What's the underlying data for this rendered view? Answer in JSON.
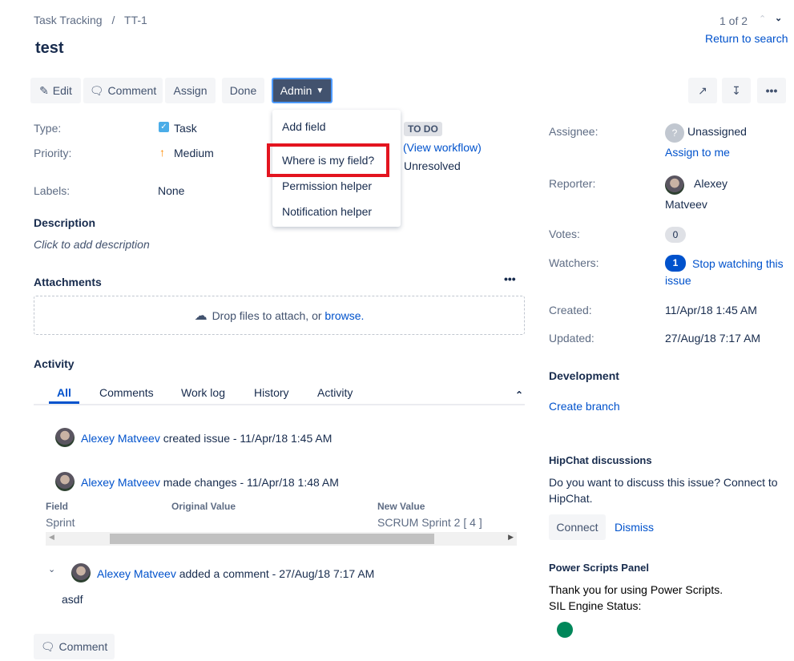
{
  "breadcrumb": {
    "project": "Task Tracking",
    "sep": "/",
    "issue_key": "TT-1"
  },
  "title": "test",
  "pager": {
    "text": "1 of 2",
    "return": "Return to search"
  },
  "toolbar": {
    "edit": "Edit",
    "comment": "Comment",
    "assign": "Assign",
    "done": "Done",
    "admin": "Admin"
  },
  "admin_menu": [
    "Add field",
    "Where is my field?",
    "Permission helper",
    "Notification helper"
  ],
  "details": {
    "type_label": "Type:",
    "type": "Task",
    "priority_label": "Priority:",
    "priority": "Medium",
    "labels_label": "Labels:",
    "labels": "None",
    "status": "TO DO",
    "view_workflow": "(View workflow)",
    "resolution": "Unresolved"
  },
  "description": {
    "heading": "Description",
    "placeholder": "Click to add description"
  },
  "attachments": {
    "heading": "Attachments",
    "drop": "Drop files to attach, or ",
    "browse": "browse."
  },
  "activity": {
    "heading": "Activity",
    "tabs": [
      "All",
      "Comments",
      "Work log",
      "History",
      "Activity"
    ],
    "entries": [
      {
        "user": "Alexey Matveev",
        "text": "created issue - 11/Apr/18 1:45 AM"
      },
      {
        "user": "Alexey Matveev",
        "text": "made changes - 11/Apr/18 1:48 AM"
      },
      {
        "user": "Alexey Matveev",
        "text": "added a comment - 27/Aug/18 7:17 AM"
      }
    ],
    "changes": {
      "headers": [
        "Field",
        "Original Value",
        "New Value"
      ],
      "row": [
        "Sprint",
        "",
        "SCRUM Sprint 2 [ 4 ]"
      ]
    },
    "comment_body": "asdf",
    "comment_button": "Comment"
  },
  "people": {
    "assignee_label": "Assignee:",
    "assignee": "Unassigned",
    "assign_to_me": "Assign to me",
    "reporter_label": "Reporter:",
    "reporter_first": "Alexey",
    "reporter_last": "Matveev",
    "votes_label": "Votes:",
    "votes": "0",
    "watchers_label": "Watchers:",
    "watchers": "1",
    "stop_watching_1": "Stop watching this",
    "stop_watching_2": "issue"
  },
  "dates": {
    "created_label": "Created:",
    "created": "11/Apr/18 1:45 AM",
    "updated_label": "Updated:",
    "updated": "27/Aug/18 7:17 AM"
  },
  "development": {
    "heading": "Development",
    "create_branch": "Create branch"
  },
  "hipchat": {
    "heading": "HipChat discussions",
    "text1": "Do you want to discuss this issue? Connect to",
    "text2": "HipChat.",
    "connect": "Connect",
    "dismiss": "Dismiss"
  },
  "power_scripts": {
    "heading": "Power Scripts Panel",
    "text1": "Thank you for using Power Scripts.",
    "text2": "SIL Engine Status:",
    "status_color": "#00875a"
  }
}
